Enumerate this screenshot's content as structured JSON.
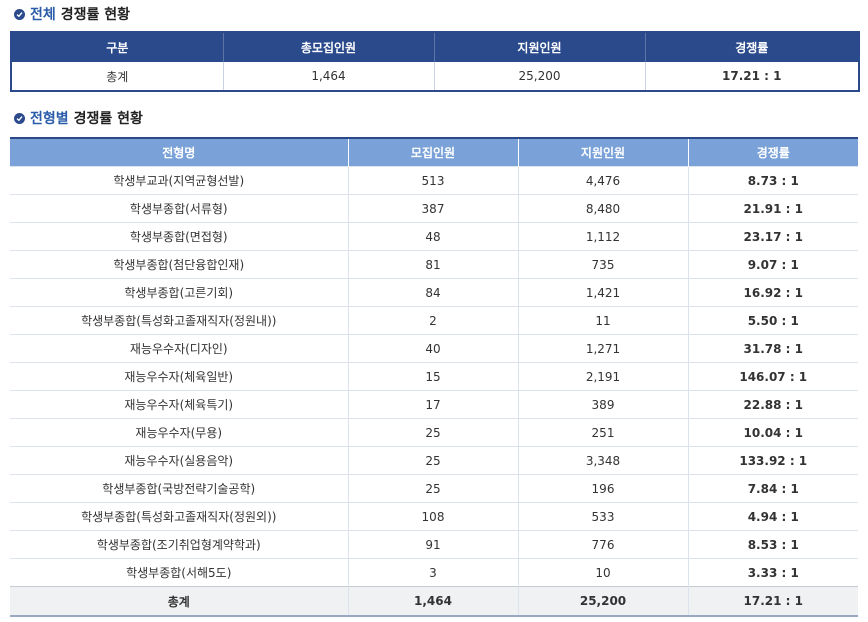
{
  "summary": {
    "title_accent": "전체",
    "title_rest": "경쟁률 현황",
    "headers": [
      "구분",
      "총모집인원",
      "지원인원",
      "경쟁률"
    ],
    "row": [
      "총계",
      "1,464",
      "25,200",
      "17.21 : 1"
    ]
  },
  "detail": {
    "title_accent": "전형별",
    "title_rest": "경쟁률 현황",
    "headers": [
      "전형명",
      "모집인원",
      "지원인원",
      "경쟁률"
    ],
    "rows": [
      [
        "학생부교과(지역균형선발)",
        "513",
        "4,476",
        "8.73 : 1"
      ],
      [
        "학생부종합(서류형)",
        "387",
        "8,480",
        "21.91 : 1"
      ],
      [
        "학생부종합(면접형)",
        "48",
        "1,112",
        "23.17 : 1"
      ],
      [
        "학생부종합(첨단융합인재)",
        "81",
        "735",
        "9.07 : 1"
      ],
      [
        "학생부종합(고른기회)",
        "84",
        "1,421",
        "16.92 : 1"
      ],
      [
        "학생부종합(특성화고졸재직자(정원내))",
        "2",
        "11",
        "5.50 : 1"
      ],
      [
        "재능우수자(디자인)",
        "40",
        "1,271",
        "31.78 : 1"
      ],
      [
        "재능우수자(체육일반)",
        "15",
        "2,191",
        "146.07 : 1"
      ],
      [
        "재능우수자(체육특기)",
        "17",
        "389",
        "22.88 : 1"
      ],
      [
        "재능우수자(무용)",
        "25",
        "251",
        "10.04 : 1"
      ],
      [
        "재능우수자(실용음악)",
        "25",
        "3,348",
        "133.92 : 1"
      ],
      [
        "학생부종합(국방전략기술공학)",
        "25",
        "196",
        "7.84 : 1"
      ],
      [
        "학생부종합(특성화고졸재직자(정원외))",
        "108",
        "533",
        "4.94 : 1"
      ],
      [
        "학생부종합(조기취업형계약학과)",
        "91",
        "776",
        "8.53 : 1"
      ],
      [
        "학생부종합(서해5도)",
        "3",
        "10",
        "3.33 : 1"
      ]
    ],
    "total": [
      "총계",
      "1,464",
      "25,200",
      "17.21 : 1"
    ]
  }
}
